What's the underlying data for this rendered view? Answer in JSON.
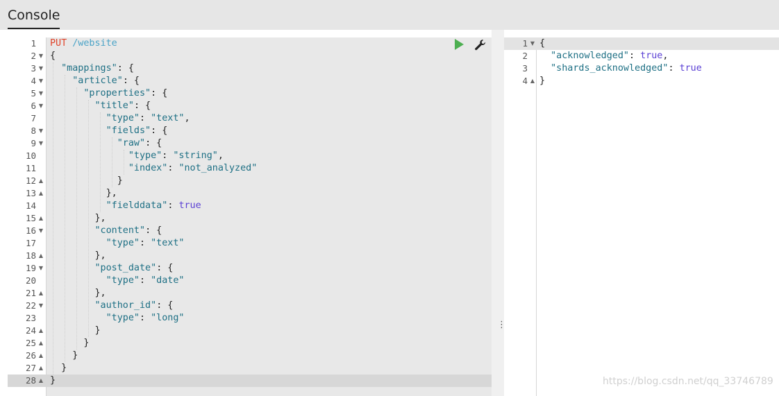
{
  "header": {
    "tab_label": "Console"
  },
  "request": {
    "method": "PUT",
    "path": " /website",
    "lines": [
      {
        "n": "1",
        "fold": "",
        "tokens": [
          [
            "m",
            "PUT"
          ],
          [
            "u",
            " /website"
          ]
        ]
      },
      {
        "n": "2",
        "fold": "down",
        "tokens": [
          [
            "p",
            "{"
          ]
        ]
      },
      {
        "n": "3",
        "fold": "down",
        "tokens": [
          [
            "p",
            "  "
          ],
          [
            "k",
            "\"mappings\""
          ],
          [
            "p",
            ": {"
          ]
        ]
      },
      {
        "n": "4",
        "fold": "down",
        "tokens": [
          [
            "p",
            "    "
          ],
          [
            "k",
            "\"article\""
          ],
          [
            "p",
            ": {"
          ]
        ]
      },
      {
        "n": "5",
        "fold": "down",
        "tokens": [
          [
            "p",
            "      "
          ],
          [
            "k",
            "\"properties\""
          ],
          [
            "p",
            ": {"
          ]
        ]
      },
      {
        "n": "6",
        "fold": "down",
        "tokens": [
          [
            "p",
            "        "
          ],
          [
            "k",
            "\"title\""
          ],
          [
            "p",
            ": {"
          ]
        ]
      },
      {
        "n": "7",
        "fold": "",
        "tokens": [
          [
            "p",
            "          "
          ],
          [
            "k",
            "\"type\""
          ],
          [
            "p",
            ": "
          ],
          [
            "s",
            "\"text\""
          ],
          [
            "p",
            ","
          ]
        ]
      },
      {
        "n": "8",
        "fold": "down",
        "tokens": [
          [
            "p",
            "          "
          ],
          [
            "k",
            "\"fields\""
          ],
          [
            "p",
            ": {"
          ]
        ]
      },
      {
        "n": "9",
        "fold": "down",
        "tokens": [
          [
            "p",
            "            "
          ],
          [
            "k",
            "\"raw\""
          ],
          [
            "p",
            ": {"
          ]
        ]
      },
      {
        "n": "10",
        "fold": "",
        "tokens": [
          [
            "p",
            "              "
          ],
          [
            "k",
            "\"type\""
          ],
          [
            "p",
            ": "
          ],
          [
            "s",
            "\"string\""
          ],
          [
            "p",
            ","
          ]
        ]
      },
      {
        "n": "11",
        "fold": "",
        "tokens": [
          [
            "p",
            "              "
          ],
          [
            "k",
            "\"index\""
          ],
          [
            "p",
            ": "
          ],
          [
            "s",
            "\"not_analyzed\""
          ]
        ]
      },
      {
        "n": "12",
        "fold": "up",
        "tokens": [
          [
            "p",
            "            }"
          ]
        ]
      },
      {
        "n": "13",
        "fold": "up",
        "tokens": [
          [
            "p",
            "          },"
          ]
        ]
      },
      {
        "n": "14",
        "fold": "",
        "tokens": [
          [
            "p",
            "          "
          ],
          [
            "k",
            "\"fielddata\""
          ],
          [
            "p",
            ": "
          ],
          [
            "b",
            "true"
          ]
        ]
      },
      {
        "n": "15",
        "fold": "up",
        "tokens": [
          [
            "p",
            "        },"
          ]
        ]
      },
      {
        "n": "16",
        "fold": "down",
        "tokens": [
          [
            "p",
            "        "
          ],
          [
            "k",
            "\"content\""
          ],
          [
            "p",
            ": {"
          ]
        ]
      },
      {
        "n": "17",
        "fold": "",
        "tokens": [
          [
            "p",
            "          "
          ],
          [
            "k",
            "\"type\""
          ],
          [
            "p",
            ": "
          ],
          [
            "s",
            "\"text\""
          ]
        ]
      },
      {
        "n": "18",
        "fold": "up",
        "tokens": [
          [
            "p",
            "        },"
          ]
        ]
      },
      {
        "n": "19",
        "fold": "down",
        "tokens": [
          [
            "p",
            "        "
          ],
          [
            "k",
            "\"post_date\""
          ],
          [
            "p",
            ": {"
          ]
        ]
      },
      {
        "n": "20",
        "fold": "",
        "tokens": [
          [
            "p",
            "          "
          ],
          [
            "k",
            "\"type\""
          ],
          [
            "p",
            ": "
          ],
          [
            "s",
            "\"date\""
          ]
        ]
      },
      {
        "n": "21",
        "fold": "up",
        "tokens": [
          [
            "p",
            "        },"
          ]
        ]
      },
      {
        "n": "22",
        "fold": "down",
        "tokens": [
          [
            "p",
            "        "
          ],
          [
            "k",
            "\"author_id\""
          ],
          [
            "p",
            ": {"
          ]
        ]
      },
      {
        "n": "23",
        "fold": "",
        "tokens": [
          [
            "p",
            "          "
          ],
          [
            "k",
            "\"type\""
          ],
          [
            "p",
            ": "
          ],
          [
            "s",
            "\"long\""
          ]
        ]
      },
      {
        "n": "24",
        "fold": "up",
        "tokens": [
          [
            "p",
            "        }"
          ]
        ]
      },
      {
        "n": "25",
        "fold": "up",
        "tokens": [
          [
            "p",
            "      }"
          ]
        ]
      },
      {
        "n": "26",
        "fold": "up",
        "tokens": [
          [
            "p",
            "    }"
          ]
        ]
      },
      {
        "n": "27",
        "fold": "up",
        "tokens": [
          [
            "p",
            "  }"
          ]
        ]
      },
      {
        "n": "28",
        "fold": "up",
        "tokens": [
          [
            "p",
            "}"
          ]
        ]
      }
    ]
  },
  "response": {
    "lines": [
      {
        "n": "1",
        "fold": "down",
        "tokens": [
          [
            "p",
            "{"
          ]
        ]
      },
      {
        "n": "2",
        "fold": "",
        "tokens": [
          [
            "p",
            "  "
          ],
          [
            "k",
            "\"acknowledged\""
          ],
          [
            "p",
            ": "
          ],
          [
            "b",
            "true"
          ],
          [
            "p",
            ","
          ]
        ]
      },
      {
        "n": "3",
        "fold": "",
        "tokens": [
          [
            "p",
            "  "
          ],
          [
            "k",
            "\"shards_acknowledged\""
          ],
          [
            "p",
            ": "
          ],
          [
            "b",
            "true"
          ]
        ]
      },
      {
        "n": "4",
        "fold": "up",
        "tokens": [
          [
            "p",
            "}"
          ]
        ]
      }
    ]
  },
  "icons": {
    "run": "play-icon",
    "settings": "wrench-icon",
    "splitter": "vertical-ellipsis-icon"
  },
  "colors": {
    "method": "#e0452b",
    "url": "#4aa3c7",
    "key": "#1d6f84",
    "boolean": "#5a3fd4",
    "run": "#4caf50"
  },
  "splitter_glyph": "⋮",
  "watermark": "https://blog.csdn.net/qq_33746789"
}
